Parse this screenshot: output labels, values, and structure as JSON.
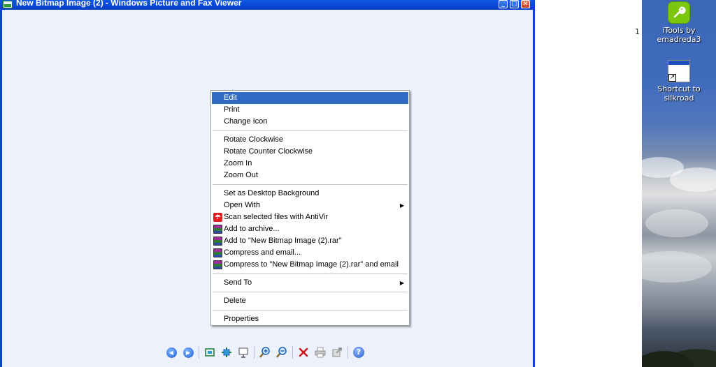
{
  "window": {
    "title": "New Bitmap Image (2) - Windows Picture and Fax Viewer",
    "controls": {
      "minimize": "_",
      "maximize": "□",
      "close": "✕"
    }
  },
  "context_menu": {
    "items": [
      {
        "label": "Edit",
        "highlighted": true
      },
      {
        "label": "Print"
      },
      {
        "label": "Change Icon"
      },
      {
        "label": "Rotate Clockwise"
      },
      {
        "label": "Rotate Counter Clockwise"
      },
      {
        "label": "Zoom In"
      },
      {
        "label": "Zoom Out"
      },
      {
        "label": "Set as Desktop Background"
      },
      {
        "label": "Open With",
        "submenu": "▶"
      },
      {
        "label": "Scan selected files with AntiVir",
        "icon": "antivir-icon"
      },
      {
        "label": "Add to archive...",
        "icon": "winrar-icon"
      },
      {
        "label": "Add to \"New Bitmap Image (2).rar\"",
        "icon": "winrar-icon"
      },
      {
        "label": "Compress and email...",
        "icon": "winrar-icon"
      },
      {
        "label": "Compress to \"New Bitmap Image (2).rar\" and email",
        "icon": "winrar-icon"
      },
      {
        "label": "Send To",
        "submenu": "▶"
      },
      {
        "label": "Delete"
      },
      {
        "label": "Properties"
      }
    ]
  },
  "toolbar": {
    "buttons": [
      "previous-image-icon",
      "next-image-icon",
      "best-fit-icon",
      "actual-size-icon",
      "slideshow-icon",
      "zoom-in-icon",
      "zoom-out-icon",
      "delete-icon",
      "print-icon",
      "copy-to-icon",
      "help-icon"
    ]
  },
  "desktop": {
    "partial_label": "1",
    "icons": [
      {
        "label_line1": "iTools by",
        "label_line2": "emadreda3"
      },
      {
        "label_line1": "Shortcut to",
        "label_line2": "silkroad"
      }
    ]
  },
  "colors": {
    "titlebar": "#0a46d4",
    "menu_highlight": "#316ac5",
    "viewer_background": "#edf1fb"
  }
}
